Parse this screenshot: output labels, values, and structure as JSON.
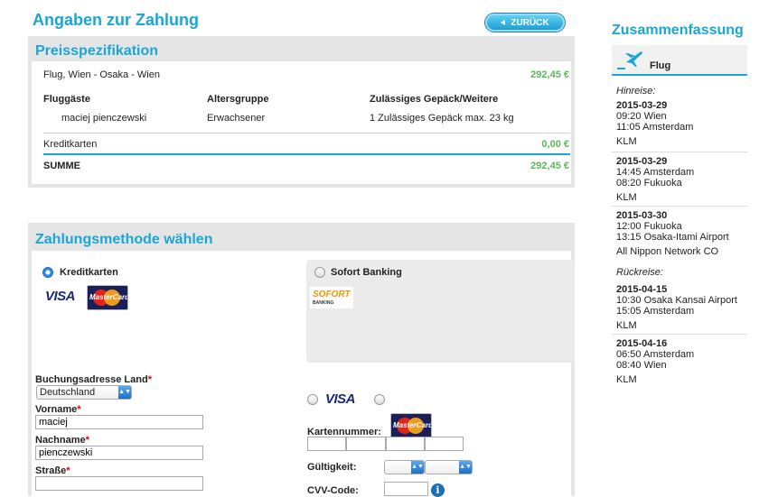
{
  "header": {
    "title": "Angaben zur Zahlung",
    "back_label": "ZURÜCK"
  },
  "price": {
    "title": "Preisspezifikation",
    "route": "Flug, Wien - Osaka - Wien",
    "route_amount": "292,45 €",
    "columns": [
      "Fluggäste",
      "Altersgruppe",
      "Zulässiges Gepäck/Weitere"
    ],
    "passenger": {
      "name": "maciej pienczewski",
      "age": "Erwachsener",
      "baggage": "1 Zulässiges Gepäck max. 23 kg"
    },
    "card_fee_label": "Kreditkarten",
    "card_fee_amount": "0,00 €",
    "total_label": "SUMME",
    "total_amount": "292,45 €"
  },
  "payment": {
    "title": "Zahlungsmethode wählen",
    "credit_label": "Kreditkarten",
    "credit_selected": true,
    "sofort_label": "Sofort Banking",
    "sofort_logo_top": "SOFORT",
    "sofort_logo_bottom": "BANKING",
    "visa": "VISA",
    "mastercard": "MasterCard"
  },
  "address": {
    "country_label": "Buchungsadresse Land",
    "country_value": "Deutschland",
    "firstname_label": "Vorname",
    "firstname_value": "maciej",
    "lastname_label": "Nachname",
    "lastname_value": "pienczewski",
    "street_label": "Straße",
    "street_value": "",
    "required_mark": "*"
  },
  "card": {
    "number_label": "Kartennummer:",
    "validity_label": "Gültigkeit:",
    "cvv_label": "CVV-Code:",
    "info_icon": "i"
  },
  "summary": {
    "title": "Zusammenfassung",
    "flight_label": "Flug",
    "outbound_label": "Hinreise:",
    "return_label": "Rückreise:",
    "outbound": [
      {
        "date": "2015-03-29",
        "dep": "09:20 Wien",
        "arr": "11:05 Amsterdam",
        "airline": "KLM"
      },
      {
        "date": "2015-03-29",
        "dep": "14:45 Amsterdam",
        "arr": "08:20 Fukuoka",
        "airline": "KLM"
      },
      {
        "date": "2015-03-30",
        "dep": "12:00 Fukuoka",
        "arr": "13:15 Osaka-Itami Airport",
        "airline": "All Nippon Network CO"
      }
    ],
    "return": [
      {
        "date": "2015-04-15",
        "dep": "10:30 Osaka Kansai Airport",
        "arr": "15:05 Amsterdam",
        "airline": "KLM"
      },
      {
        "date": "2015-04-16",
        "dep": "06:50 Amsterdam",
        "arr": "08:40 Wien",
        "airline": "KLM"
      }
    ]
  },
  "colors": {
    "accent": "#1aa6d6",
    "amount": "#5cb85c",
    "required": "#dd0000"
  }
}
